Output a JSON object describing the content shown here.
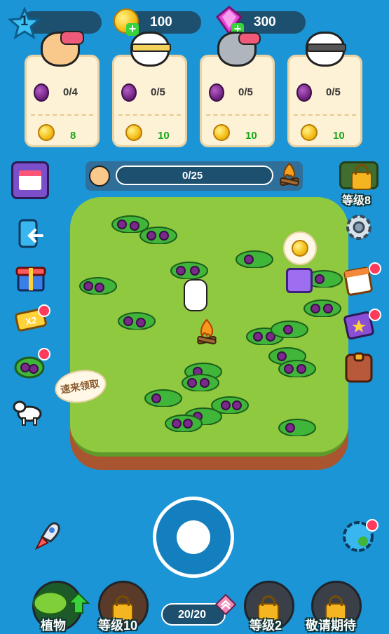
{
  "hud": {
    "level": "1",
    "coins": "100",
    "gems": "300"
  },
  "orders": [
    {
      "count": "0/4",
      "reward": "8"
    },
    {
      "count": "0/5",
      "reward": "10"
    },
    {
      "count": "0/5",
      "reward": "10"
    },
    {
      "count": "0/5",
      "reward": "10"
    }
  ],
  "progress": {
    "label": "0/25",
    "fraction": 0
  },
  "locked_top_right_label": "等级8",
  "speech_bubble": "速来领取",
  "bottom": {
    "plants_label": "植物",
    "slot2_label": "等级10",
    "counter": "20/20",
    "slot3_label": "等级2",
    "slot4_label": "敬请期待"
  },
  "colors": {
    "sea": "#1b95d6",
    "grass": "#8fc93f",
    "accent_green": "#1aa61a"
  }
}
